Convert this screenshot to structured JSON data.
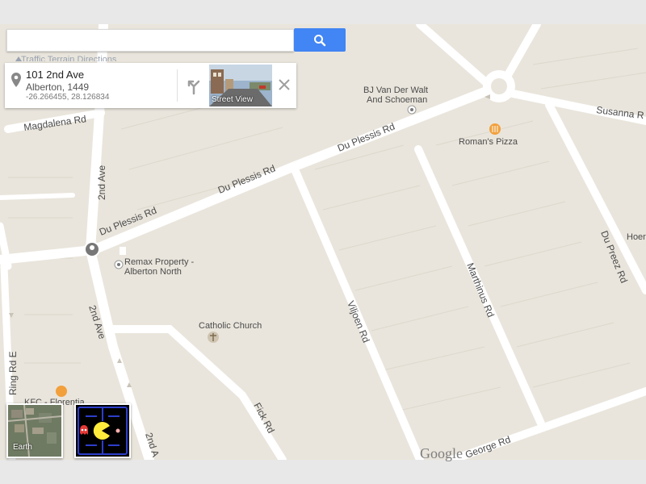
{
  "search": {
    "value": "",
    "placeholder": ""
  },
  "layers_strip": {
    "text": "Traffic  Terrain  Directions"
  },
  "info_card": {
    "address_line1": "101 2nd Ave",
    "address_line2": "Alberton, 1449",
    "coordinates": "-26.266455, 28.126834",
    "street_view_label": "Street View"
  },
  "roads": {
    "du_plessis_1": "Du Plessis Rd",
    "du_plessis_2": "Du Plessis Rd",
    "du_plessis_3": "Du Plessis Rd",
    "magdalena": "Magdalena Rd",
    "second_ave_1": "2nd Ave",
    "second_ave_2": "2nd Ave",
    "second_ave_3": "2nd A",
    "ring_rd": "Ring Rd E",
    "viljoen": "Viljoen Rd",
    "marthinus": "Marthinus Rd",
    "du_preez": "Du Preez Rd",
    "susanna": "Susanna R",
    "fick": "Fick Rd",
    "george": "George Rd"
  },
  "pois": {
    "bj_line1": "BJ Van Der Walt",
    "bj_line2": "And Schoeman",
    "romans": "Roman's Pizza",
    "remax_line1": "Remax Property -",
    "remax_line2": "Alberton North",
    "catholic": "Catholic Church",
    "kfc": "KFC - Florentia",
    "hoers": "Hoers"
  },
  "thumbnails": {
    "earth_label": "Earth"
  },
  "branding": {
    "logo_text": "Google"
  },
  "colors": {
    "map_background": "#e9e5dc",
    "road": "#ffffff",
    "search_button": "#4285f4"
  }
}
